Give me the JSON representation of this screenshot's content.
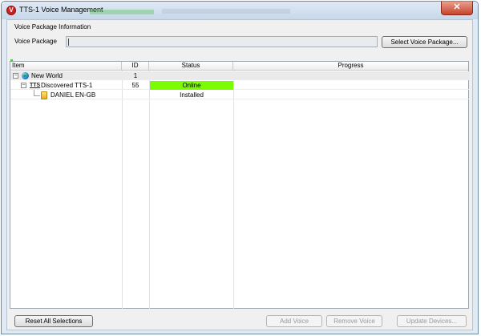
{
  "window": {
    "title": "TTS-1 Voice Management",
    "close_glyph": "✕"
  },
  "voice_package": {
    "group_title": "Voice Package Information",
    "label": "Voice Package",
    "value": "",
    "select_button": "Select Voice Package..."
  },
  "grid": {
    "columns": [
      "Item",
      "ID",
      "Status",
      "Progress"
    ],
    "rows": [
      {
        "item": "New World",
        "id": "1",
        "status": "",
        "progress": "",
        "icon": "globe-icon"
      },
      {
        "item": "Discovered TTS-1",
        "id": "55",
        "status": "Online",
        "progress": "",
        "icon": "tts-icon",
        "icon_text": "TTS"
      },
      {
        "item": "DANIEL EN-GB",
        "id": "",
        "status": "Installed",
        "progress": "",
        "icon": "voice-icon"
      }
    ],
    "status_colors": {
      "online": "#7cfc00"
    },
    "expander_glyph": "−"
  },
  "buttons": {
    "reset": "Reset All Selections",
    "add": "Add Voice",
    "remove": "Remove Voice",
    "update": "Update Devices..."
  }
}
